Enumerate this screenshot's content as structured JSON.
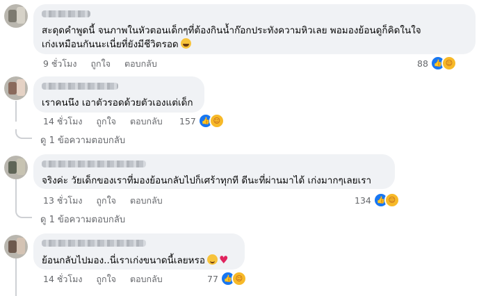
{
  "comments": [
    {
      "text_line1": "สะดุดคำพูดนี้ จนภาพในหัวตอนเด็กๆที่ต้องกินน้ำก๊อกประทังความหิวเลย พอมองย้อนดูก็คิดในใจ",
      "text_line2": "เก่งเหมือนกันนะเนี่ยที่ยังมีชีวิตรอด",
      "emoji": "grinning-sweat-emoji",
      "time": "9 ชั่วโมง",
      "like": "ถูกใจ",
      "reply": "ตอบกลับ",
      "reaction_count": "88"
    },
    {
      "text_line1": "เราคนนึง เอาตัวรอดด้วยตัวเองแต่เด็ก",
      "time": "14 ชั่วโมง",
      "like": "ถูกใจ",
      "reply": "ตอบกลับ",
      "reaction_count": "157",
      "view_replies": "ดู 1 ข้อความตอบกลับ"
    },
    {
      "text_line1": "จริงค่ะ วัยเด็กของเราที่มองย้อนกลับไปก็เศร้าทุกที ดีนะที่ผ่านมาได้ เก่งมากๆเลยเรา",
      "time": "13 ชั่วโมง",
      "like": "ถูกใจ",
      "reply": "ตอบกลับ",
      "reaction_count": "134",
      "view_replies": "ดู 1 ข้อความตอบกลับ"
    },
    {
      "text_line1": "ย้อนกลับไปมอง..นี่เราเก่งขนาดนี้เลยหรอ",
      "emoji": "smiling-emoji",
      "heart": "♥",
      "time": "14 ชั่วโมง",
      "like": "ถูกใจ",
      "reply": "ตอบกลับ",
      "reaction_count": "77"
    }
  ],
  "reaction_icons": [
    "like-icon",
    "care-icon"
  ],
  "colors": {
    "bubble": "#f0f2f5",
    "meta_text": "#65676b",
    "like_blue": "#1877f2",
    "care_yellow": "#f7b928"
  }
}
